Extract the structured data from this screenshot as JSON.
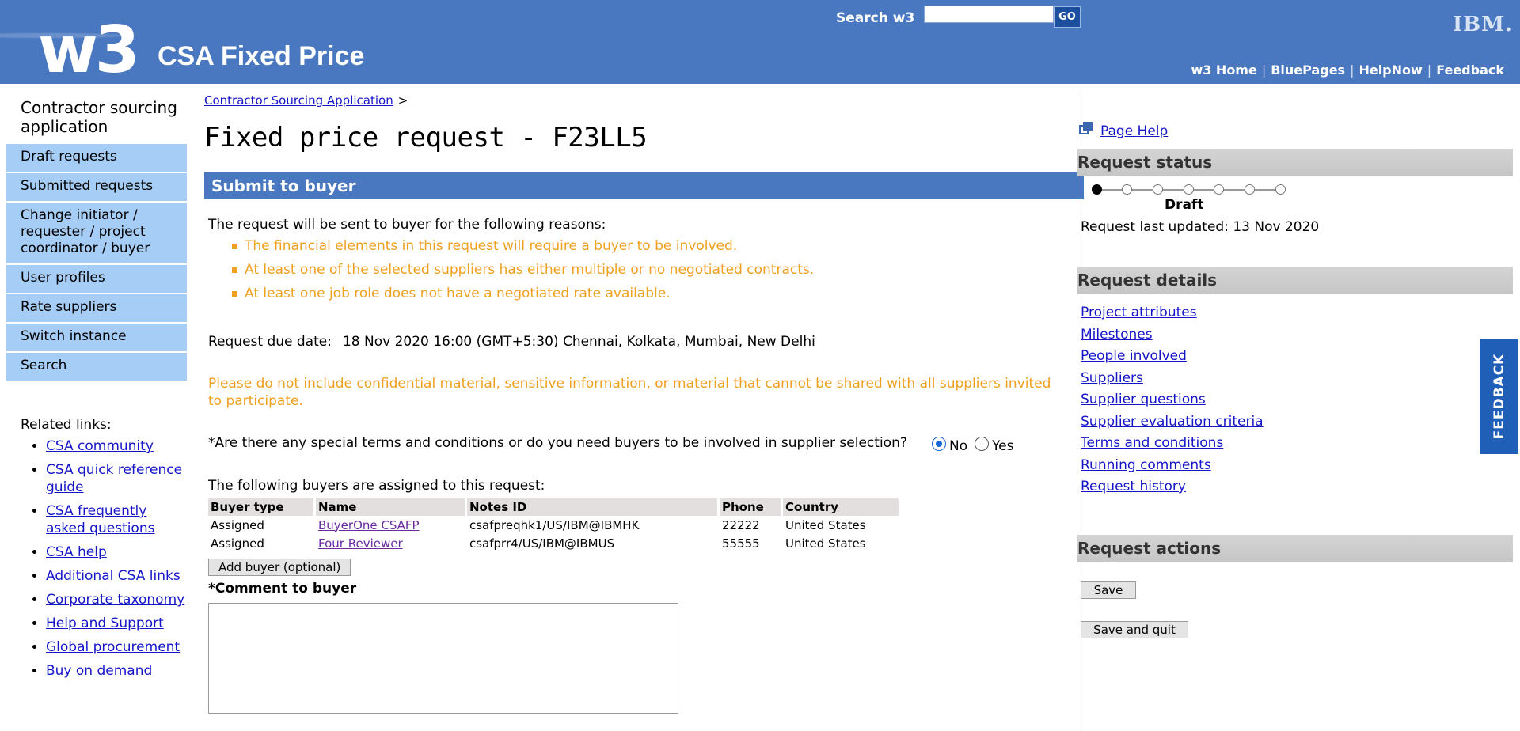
{
  "header": {
    "logo_text": "w3",
    "site_title": "CSA Fixed Price",
    "search_label": "Search w3",
    "search_value": "",
    "go_label": "GO",
    "ibm_logo": "IBM.",
    "top_links": [
      "w3 Home",
      "BluePages",
      "HelpNow",
      "Feedback"
    ]
  },
  "leftnav": {
    "app_title": "Contractor sourcing application",
    "items": [
      "Draft requests",
      "Submitted requests",
      "Change initiator / requester / project coordinator / buyer",
      "User profiles",
      "Rate suppliers",
      "Switch instance",
      "Search"
    ],
    "related_title": "Related links:",
    "related_links": [
      "CSA community",
      "CSA quick reference guide",
      "CSA frequently asked questions",
      "CSA help",
      "Additional CSA links",
      "Corporate taxonomy",
      "Help and Support",
      "Global procurement",
      "Buy on demand"
    ]
  },
  "main": {
    "breadcrumb_link": "Contractor Sourcing Application",
    "breadcrumb_sep": ">",
    "page_title": "Fixed price request - F23LL5",
    "section_title": "Submit to buyer",
    "intro": "The request will be sent to buyer for the following reasons:",
    "reasons": [
      "The financial elements in this request will require a buyer to be involved.",
      "At least one of the selected suppliers has either multiple or no negotiated contracts.",
      "At least one job role does not have a negotiated rate available."
    ],
    "due_label": "Request due date:",
    "due_value": "18 Nov 2020 16:00 (GMT+5:30) Chennai, Kolkata, Mumbai, New Delhi",
    "warning": "Please do not include confidential material, sensitive information, or material that cannot be shared with all suppliers invited to participate.",
    "question": "*Are there any special terms and conditions or do you need buyers to be involved in supplier selection?",
    "radio_no": "No",
    "radio_yes": "Yes",
    "selected_option": "No",
    "buyers_intro": "The following buyers are assigned to this request:",
    "buyers_table": {
      "headers": [
        "Buyer type",
        "Name",
        "Notes ID",
        "Phone",
        "Country"
      ],
      "rows": [
        [
          "Assigned",
          "BuyerOne CSAFP",
          "csafpreqhk1/US/IBM@IBMHK",
          "22222",
          "United States"
        ],
        [
          "Assigned",
          "Four Reviewer",
          "csafprr4/US/IBM@IBMUS",
          "55555",
          "United States"
        ]
      ]
    },
    "add_buyer_label": "Add buyer (optional)",
    "comment_label": "*Comment to buyer",
    "comment_value": ""
  },
  "right": {
    "page_help": "Page Help",
    "status_title": "Request status",
    "status_label": "Draft",
    "status_steps_total": 7,
    "status_current_step": 1,
    "last_updated": "Request last updated: 13 Nov 2020",
    "details_title": "Request details",
    "details_links": [
      "Project attributes",
      "Milestones",
      "People involved",
      "Suppliers",
      "Supplier questions",
      "Supplier evaluation criteria",
      "Terms and conditions",
      "Running comments",
      "Request history"
    ],
    "actions_title": "Request actions",
    "save_label": "Save",
    "save_quit_label": "Save and quit"
  },
  "feedback_tab": "FEEDBACK",
  "colors": {
    "masthead": "#4a78c0",
    "nav_item": "#a5cdf6",
    "warning_text": "#f0a020",
    "feedback_tab": "#1f5fb8"
  }
}
